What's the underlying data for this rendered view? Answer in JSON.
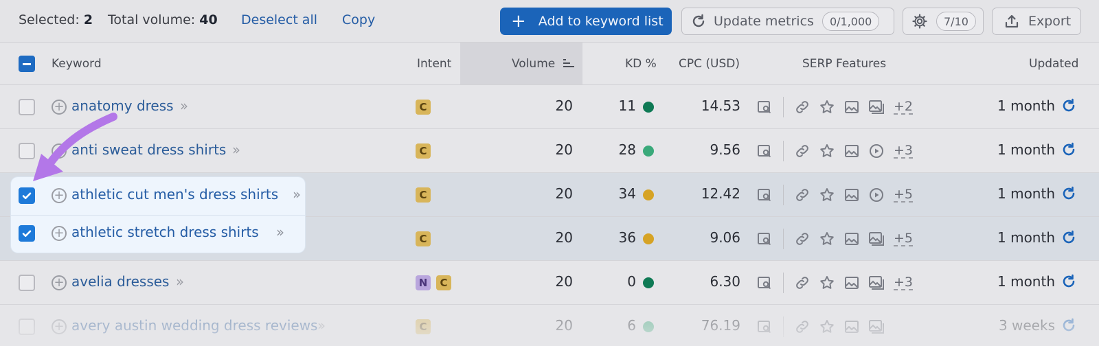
{
  "toolbar": {
    "selected_label": "Selected:",
    "selected_count": "2",
    "total_label": "Total volume:",
    "total_value": "40",
    "deselect_all": "Deselect all",
    "copy": "Copy",
    "add_to_list": "Add to keyword list",
    "update_metrics": "Update metrics",
    "update_counter": "0/1,000",
    "settings_counter": "7/10",
    "export": "Export"
  },
  "columns": {
    "keyword": "Keyword",
    "intent": "Intent",
    "volume": "Volume",
    "kd": "KD %",
    "cpc": "CPC (USD)",
    "serp": "SERP Features",
    "updated": "Updated"
  },
  "colors": {
    "accent": "#1b64b9",
    "kd_dark_green": "#0f7a55",
    "kd_light_green": "#3aa97a",
    "kd_yellow": "#d6a325"
  },
  "rows": [
    {
      "keyword": "anatomy dress",
      "intents": [
        "C"
      ],
      "volume": "20",
      "kd": "11",
      "kd_color": "#0f7a55",
      "cpc": "14.53",
      "serp_more": "+2",
      "updated": "1 month",
      "selected": false
    },
    {
      "keyword": "anti sweat dress shirts",
      "intents": [
        "C"
      ],
      "volume": "20",
      "kd": "28",
      "kd_color": "#3aa97a",
      "cpc": "9.56",
      "serp_more": "+3",
      "updated": "1 month",
      "selected": false
    },
    {
      "keyword": "athletic cut men's dress shirts",
      "intents": [
        "C"
      ],
      "volume": "20",
      "kd": "34",
      "kd_color": "#d6a325",
      "cpc": "12.42",
      "serp_more": "+5",
      "updated": "1 month",
      "selected": true
    },
    {
      "keyword": "athletic stretch dress shirts",
      "intents": [
        "C"
      ],
      "volume": "20",
      "kd": "36",
      "kd_color": "#d6a325",
      "cpc": "9.06",
      "serp_more": "+5",
      "updated": "1 month",
      "selected": true
    },
    {
      "keyword": "avelia dresses",
      "intents": [
        "N",
        "C"
      ],
      "volume": "20",
      "kd": "0",
      "kd_color": "#0f7a55",
      "cpc": "6.30",
      "serp_more": "+3",
      "updated": "1 month",
      "selected": false
    },
    {
      "keyword": "avery austin wedding dress reviews",
      "intents": [
        "C"
      ],
      "volume": "20",
      "kd": "6",
      "kd_color": "#3aa97a",
      "cpc": "76.19",
      "serp_more": "",
      "updated": "3 weeks",
      "selected": false
    }
  ]
}
